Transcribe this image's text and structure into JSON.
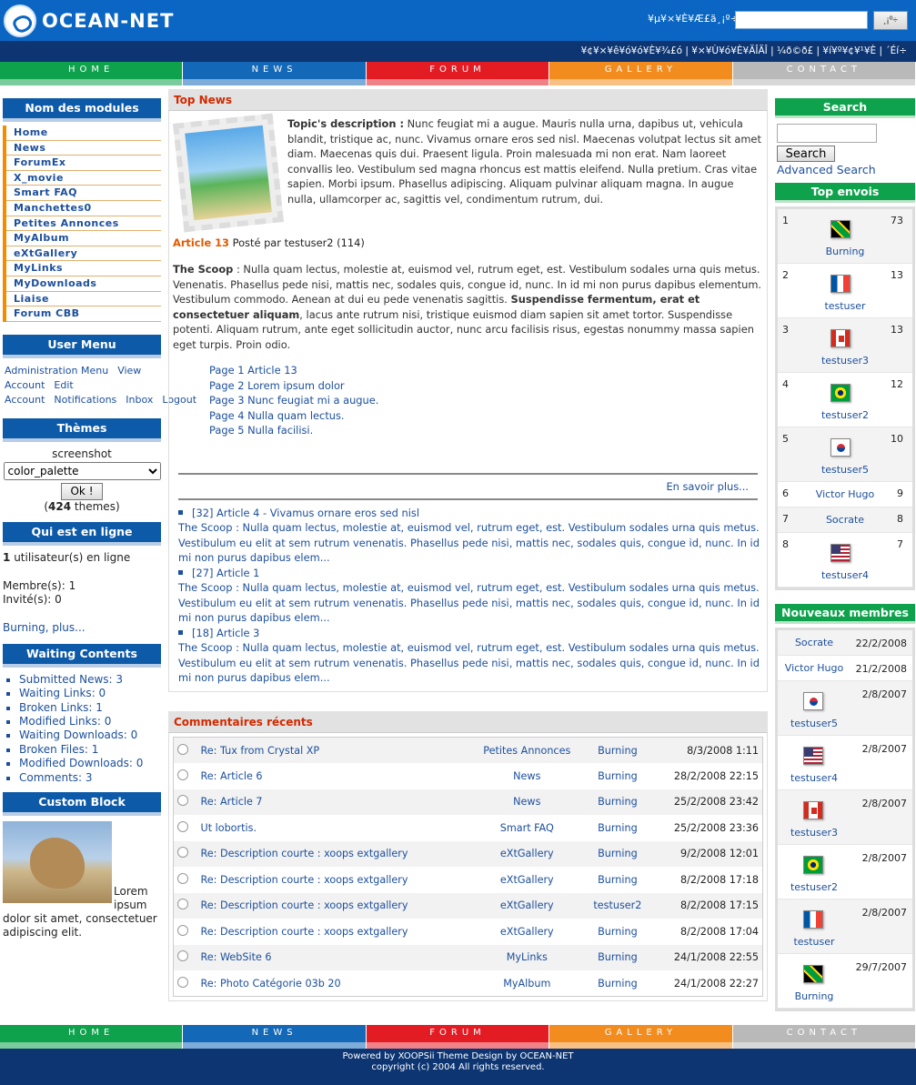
{
  "header": {
    "logo": "OCEAN-NET",
    "search_label": "¥µ¥×¥È¥Æ£ã¸¡º÷¡§",
    "search_button": "¸¡º÷"
  },
  "subbar": {
    "text": "¥¢¥×¥ê¥ó¥ó¥È¥¾£ó | ¥×¥Ù¥ó¥È¥ÄÎÄÎ | ¼ð©ð£ | ¥í¥º¥¢¥¹¥È | ´Éí÷"
  },
  "nav": [
    "HOME",
    "NEWS",
    "FORUM",
    "GALLERY",
    "CONTACT"
  ],
  "nav_colors": [
    "#0ea24c",
    "#1368b8",
    "#e31b23",
    "#f28c1e",
    "#b9b9b9"
  ],
  "modules": {
    "title": "Nom des modules",
    "items": [
      "Home",
      "News",
      "ForumEx",
      "X_movie",
      "Smart FAQ",
      "Manchettes0",
      "Petites Annonces",
      "MyAlbum",
      "eXtGallery",
      "MyLinks",
      "MyDownloads",
      "Liaise",
      "Forum CBB"
    ]
  },
  "usermenu": {
    "title": "User Menu",
    "items": [
      "Administration Menu",
      "View Account",
      "Edit Account",
      "Notifications",
      "Inbox",
      "Logout"
    ]
  },
  "themes": {
    "title": "Thèmes",
    "screenshot": "screenshot",
    "selected": "color_palette",
    "button": "Ok !",
    "count": "424",
    "suffix": "themes"
  },
  "online": {
    "title": "Qui est en ligne",
    "count": "1",
    "count_text": "utilisateur(s) en ligne",
    "members": "Membre(s): 1",
    "guests": "Invité(s): 0",
    "link": "Burning, plus..."
  },
  "waiting": {
    "title": "Waiting Contents",
    "items": [
      "Submitted News: 3",
      "Waiting Links: 0",
      "Broken Links: 1",
      "Modified Links: 0",
      "Waiting Downloads: 0",
      "Broken Files: 1",
      "Modified Downloads: 0",
      "Comments: 3"
    ]
  },
  "custom": {
    "title": "Custom Block",
    "text": "Lorem ipsum dolor sit amet, consectetuer adipiscing elit."
  },
  "topnews": {
    "title": "Top News",
    "topic_label": "Topic's description :",
    "topic_text": "Nunc feugiat mi a augue. Mauris nulla urna, dapibus ut, vehicula blandit, tristique ac, nunc. Vivamus ornare eros sed nisl. Maecenas volutpat lectus sit amet diam. Maecenas quis dui. Praesent ligula. Proin malesuada mi non erat. Nam laoreet convallis leo. Vestibulum sed magna rhoncus est mattis eleifend. Nulla pretium. Cras vitae sapien. Morbi ipsum. Phasellus adipiscing. Aliquam pulvinar aliquam magna. In augue nulla, ullamcorper ac, sagittis vel, condimentum rutrum, dui.",
    "article_link": "Article 13",
    "article_meta": "Posté par testuser2 (114)",
    "scoop_label": "The Scoop",
    "scoop_a": " : Nulla quam lectus, molestie at, euismod vel, rutrum eget, est. Vestibulum sodales urna quis metus. Venenatis. Phasellus pede nisi, mattis nec, sodales quis, congue id, nunc. In id mi non purus dapibus elementum. Vestibulum commodo. Aenean at dui eu pede venenatis sagittis. ",
    "scoop_bold": "Suspendisse fermentum, erat et consectetuer aliquam",
    "scoop_b": ", lacus ante rutrum nisi, tristique euismod diam sapien sit amet tortor. Suspendisse potenti. Aliquam rutrum, ante eget sollicitudin auctor, nunc arcu facilisis risus, egestas nonummy massa sapien eget turpis. Proin odio.",
    "pages": [
      "Page 1 Article 13",
      "Page 2 Lorem ipsum dolor",
      "Page 3 Nunc feugiat mi a augue.",
      "Page 4 Nulla quam lectus.",
      "Page 5 Nulla facilisi."
    ],
    "more": "En savoir plus...",
    "older": [
      {
        "title": "[32] Article 4 - Vivamus ornare eros sed nisl",
        "text": "The Scoop : Nulla quam lectus, molestie at, euismod vel, rutrum eget, est. Vestibulum sodales urna quis metus. Vestibulum eu elit at sem rutrum venenatis. Phasellus pede nisi, mattis nec, sodales quis, congue id, nunc. In id mi non purus dapibus elem..."
      },
      {
        "title": "[27] Article 1",
        "text": "The Scoop : Nulla quam lectus, molestie at, euismod vel, rutrum eget, est. Vestibulum sodales urna quis metus. Vestibulum eu elit at sem rutrum venenatis. Phasellus pede nisi, mattis nec, sodales quis, congue id, nunc. In id mi non purus dapibus elem..."
      },
      {
        "title": "[18] Article 3",
        "text": "The Scoop : Nulla quam lectus, molestie at, euismod vel, rutrum eget, est. Vestibulum sodales urna quis metus. Vestibulum eu elit at sem rutrum venenatis. Phasellus pede nisi, mattis nec, sodales quis, congue id, nunc. In id mi non purus dapibus elem..."
      }
    ]
  },
  "comments": {
    "title": "Commentaires récents",
    "rows": [
      [
        "Re: Tux from Crystal XP",
        "Petites Annonces",
        "Burning",
        "8/3/2008 1:11"
      ],
      [
        "Re: Article 6",
        "News",
        "Burning",
        "28/2/2008 22:15"
      ],
      [
        "Re: Article 7",
        "News",
        "Burning",
        "25/2/2008 23:42"
      ],
      [
        "Ut lobortis.",
        "Smart FAQ",
        "Burning",
        "25/2/2008 23:36"
      ],
      [
        "Re: Description courte : xoops extgallery",
        "eXtGallery",
        "Burning",
        "9/2/2008 12:01"
      ],
      [
        "Re: Description courte : xoops extgallery",
        "eXtGallery",
        "Burning",
        "8/2/2008 17:18"
      ],
      [
        "Re: Description courte : xoops extgallery",
        "eXtGallery",
        "testuser2",
        "8/2/2008 17:15"
      ],
      [
        "Re: Description courte : xoops extgallery",
        "eXtGallery",
        "Burning",
        "8/2/2008 17:04"
      ],
      [
        "Re: WebSite 6",
        "MyLinks",
        "Burning",
        "24/1/2008 22:55"
      ],
      [
        "Re: Photo Catégorie 03b 20",
        "MyAlbum",
        "Burning",
        "24/1/2008 22:27"
      ]
    ]
  },
  "rsearch": {
    "title": "Search",
    "button": "Search",
    "advanced": "Advanced Search"
  },
  "topenvois": {
    "title": "Top envois",
    "rows": [
      {
        "n": "1",
        "name": "Burning",
        "v": "73",
        "flag": "jm"
      },
      {
        "n": "2",
        "name": "testuser",
        "v": "13",
        "flag": "fr"
      },
      {
        "n": "3",
        "name": "testuser3",
        "v": "13",
        "flag": "ca"
      },
      {
        "n": "4",
        "name": "testuser2",
        "v": "12",
        "flag": "br"
      },
      {
        "n": "5",
        "name": "testuser5",
        "v": "10",
        "flag": "kr"
      },
      {
        "n": "6",
        "name": "Victor Hugo",
        "v": "9",
        "flag": ""
      },
      {
        "n": "7",
        "name": "Socrate",
        "v": "8",
        "flag": ""
      },
      {
        "n": "8",
        "name": "testuser4",
        "v": "7",
        "flag": "us"
      }
    ]
  },
  "newmembers": {
    "title": "Nouveaux membres",
    "rows": [
      {
        "name": "Socrate",
        "d": "22/2/2008",
        "flag": ""
      },
      {
        "name": "Victor Hugo",
        "d": "21/2/2008",
        "flag": ""
      },
      {
        "name": "testuser5",
        "d": "2/8/2007",
        "flag": "kr"
      },
      {
        "name": "testuser4",
        "d": "2/8/2007",
        "flag": "us"
      },
      {
        "name": "testuser3",
        "d": "2/8/2007",
        "flag": "ca"
      },
      {
        "name": "testuser2",
        "d": "2/8/2007",
        "flag": "br"
      },
      {
        "name": "testuser",
        "d": "2/8/2007",
        "flag": "fr"
      },
      {
        "name": "Burning",
        "d": "29/7/2007",
        "flag": "jm"
      }
    ]
  },
  "footer": {
    "line1": "Powered by XOOPSii Theme Design by OCEAN-NET",
    "line2": "copyright (c) 2004 All rights reserved."
  }
}
